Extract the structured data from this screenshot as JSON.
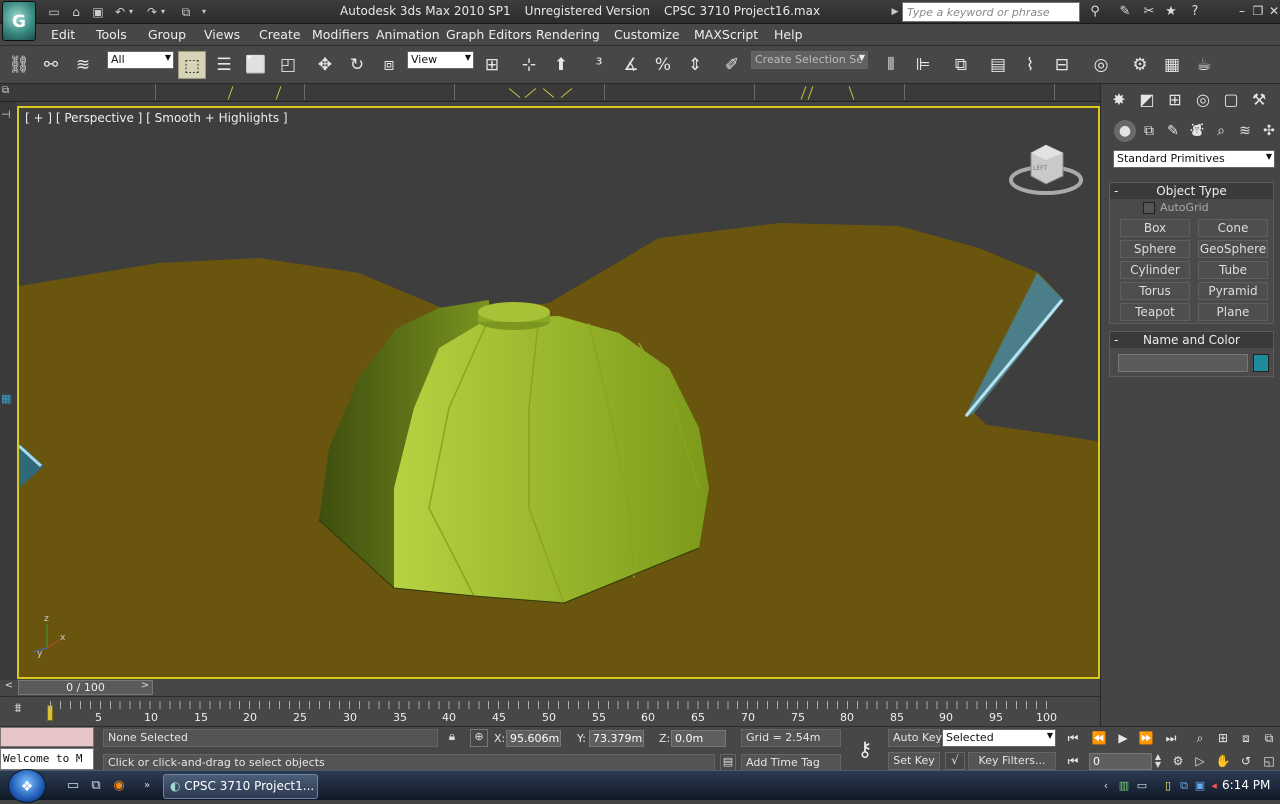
{
  "window": {
    "app_logo": "G",
    "title_app": "Autodesk 3ds Max  2010 SP1",
    "title_version": "Unregistered Version",
    "title_file": "CPSC 3710 Project16.max",
    "search_placeholder": "Type a keyword or phrase"
  },
  "menu": [
    "Edit",
    "Tools",
    "Group",
    "Views",
    "Create",
    "Modifiers",
    "Animation",
    "Graph Editors",
    "Rendering",
    "Customize",
    "MAXScript",
    "Help"
  ],
  "toolbar": {
    "selection_filter": "All",
    "reference_coord": "View",
    "named_selection": "Create Selection Se"
  },
  "viewport": {
    "label": "[ + ] [ Perspective ] [ Smooth + Highlights ]",
    "axis_z": "z",
    "axis_x": "x",
    "axis_y": "y",
    "viewcube_face": "LEFT"
  },
  "command_panel": {
    "category": "Standard Primitives",
    "object_type_title": "Object Type",
    "autogrid_label": "AutoGrid",
    "primitives": [
      "Box",
      "Cone",
      "Sphere",
      "GeoSphere",
      "Cylinder",
      "Tube",
      "Torus",
      "Pyramid",
      "Teapot",
      "Plane"
    ],
    "name_color_title": "Name and Color",
    "object_name": "",
    "object_color": "#1e8c9e"
  },
  "timeline": {
    "slider": "0 / 100",
    "ticks": [
      "5",
      "10",
      "15",
      "20",
      "25",
      "30",
      "35",
      "40",
      "45",
      "50",
      "55",
      "60",
      "65",
      "70",
      "75",
      "80",
      "85",
      "90",
      "95",
      "100"
    ]
  },
  "status": {
    "welcome": "Welcome to M",
    "selection": "None Selected",
    "prompt": "Click or click-and-drag to select objects",
    "x_label": "X:",
    "x_value": "95.606m",
    "y_label": "Y:",
    "y_value": "73.379m",
    "z_label": "Z:",
    "z_value": "0.0m",
    "grid": "Grid = 2.54m",
    "add_time_tag": "Add Time Tag",
    "auto_key": "Auto Key",
    "key_mode": "Selected",
    "set_key": "Set Key",
    "key_filters": "Key Filters...",
    "frame": "0"
  },
  "taskbar": {
    "task_label": "CPSC 3710 Project1...",
    "clock": "6:14 PM"
  }
}
